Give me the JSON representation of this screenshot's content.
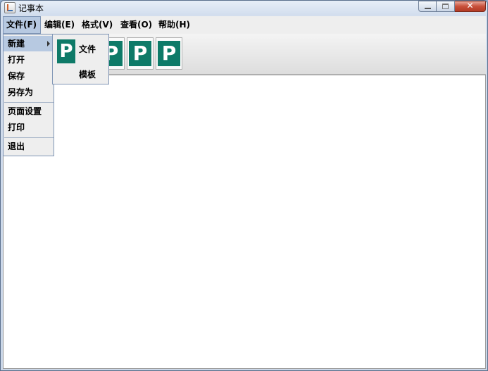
{
  "window": {
    "title": "记事本"
  },
  "menubar": [
    {
      "label": "文件(F)",
      "active": true
    },
    {
      "label": "编辑(E)"
    },
    {
      "label": "格式(V)"
    },
    {
      "label": "查看(O)"
    },
    {
      "label": "帮助(H)"
    }
  ],
  "toolbar": {
    "icon_glyph": "P",
    "icon_color": "#0e7a68"
  },
  "file_menu": {
    "items": [
      {
        "label": "新建",
        "has_submenu": true
      },
      {
        "label": "打开"
      },
      {
        "label": "保存"
      },
      {
        "label": "另存为"
      },
      {
        "label": "页面设置"
      },
      {
        "label": "打印"
      },
      {
        "label": "退出"
      }
    ]
  },
  "new_submenu": {
    "items": [
      {
        "label": "文件",
        "icon_glyph": "P"
      },
      {
        "label": "模板"
      }
    ]
  },
  "close_glyph": "✕"
}
